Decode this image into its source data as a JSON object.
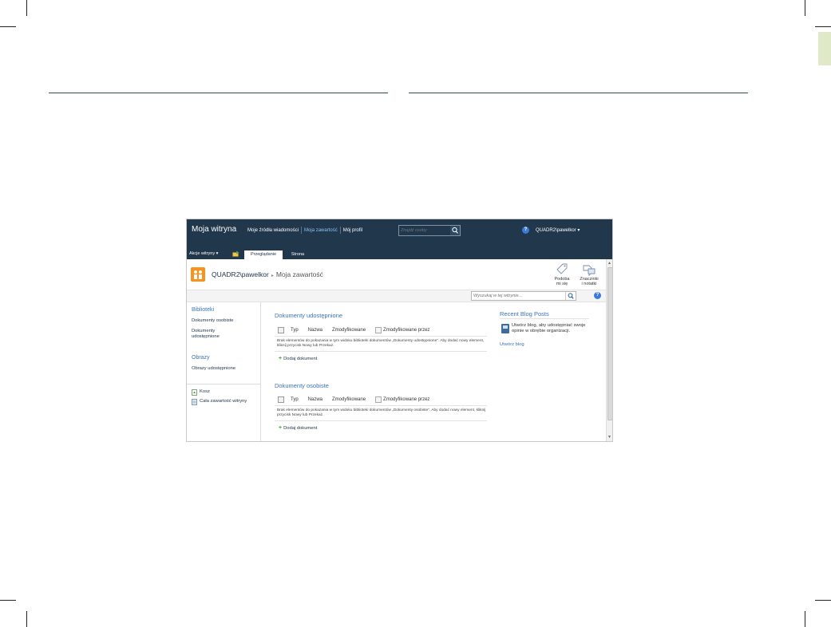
{
  "top_bar": {
    "site_title": "Moja witryna",
    "nav": [
      {
        "label": "Moje źródła wiadomości",
        "active": false
      },
      {
        "label": "Moja zawartość",
        "active": true
      },
      {
        "label": "Mój profil",
        "active": false
      }
    ],
    "people_search_placeholder": "Znajdź osoby",
    "user": "QUADR2\\pawelkor ▾"
  },
  "ribbon": {
    "site_actions": "Akcje witryny ▾",
    "tabs": [
      "Przeglądanie",
      "Strona"
    ]
  },
  "title_area": {
    "breadcrumb_root": "QUADR2\\pawelkor",
    "breadcrumb_current": "Moja zawartość",
    "like_button": [
      "Podoba",
      "mi się"
    ],
    "tags_button": [
      "Znaczniki",
      "i notatki"
    ]
  },
  "search": {
    "placeholder": "Wyszukaj w tej witrynie..."
  },
  "left_nav": {
    "libraries_heading": "Biblioteki",
    "libraries": [
      "Dokumenty osobiste",
      "Dokumenty udostępnione"
    ],
    "pictures_heading": "Obrazy",
    "pictures": [
      "Obrazy udostępnione"
    ],
    "recycle_bin": "Kosz",
    "all_content": "Cała zawartość witryny"
  },
  "shared_docs": {
    "title": "Dokumenty udostępnione",
    "columns": [
      "Typ",
      "Nazwa",
      "Zmodyfikowane",
      "Zmodyfikowane przez"
    ],
    "empty_message": "Brak elementów do pokazania w tym widoku biblioteki dokumentów „Dokumenty udostępnione”. Aby dodać nowy element, kliknij przycisk Nowy lub Przekaż.",
    "add_label": "Dodaj dokument"
  },
  "personal_docs": {
    "title": "Dokumenty osobiste",
    "columns": [
      "Typ",
      "Nazwa",
      "Zmodyfikowane",
      "Zmodyfikowane przez"
    ],
    "empty_message": "Brak elementów do pokazania w tym widoku biblioteki dokumentów „Dokumenty osobiste”. Aby dodać nowy element, kliknij przycisk Nowy lub Przekaż.",
    "add_label": "Dodaj dokument"
  },
  "blog": {
    "title": "Recent Blog Posts",
    "text": "Utwórz blog, aby udostępniać swoje opinie w obrębie organizacji.",
    "link": "Utwórz blog"
  },
  "colors": {
    "top_bar": "#21374c",
    "accent_link": "#3b73b9",
    "site_logo": "#f7921e"
  }
}
